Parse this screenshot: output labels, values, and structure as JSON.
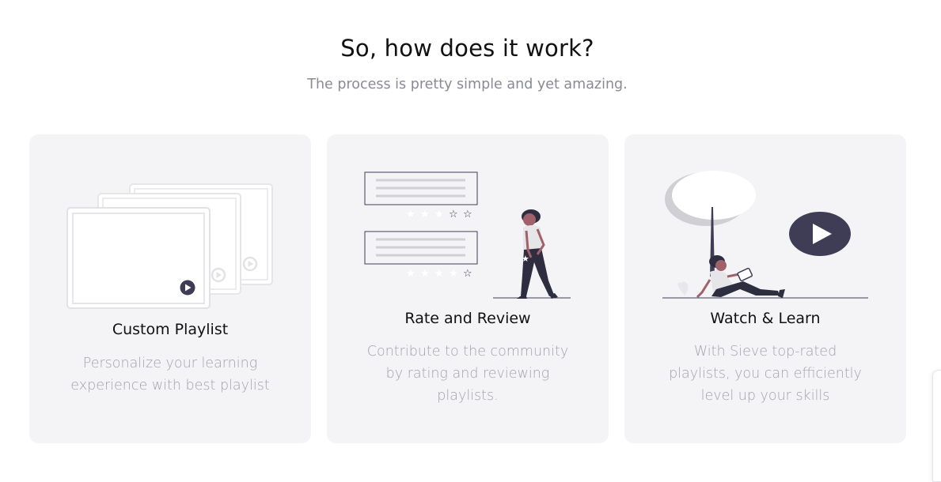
{
  "section": {
    "title": "So, how does it work?",
    "subtitle": "The process is pretty simple and yet amazing."
  },
  "cards": [
    {
      "title": "Custom Playlist",
      "description": "Personalize your learning experience with best playlist",
      "illustration": "stacked-video-playlist-icon"
    },
    {
      "title": "Rate and Review",
      "description": "Contribute to the community by rating and reviewing playlists.",
      "illustration": "person-rating-reviews-icon"
    },
    {
      "title": "Watch & Learn",
      "description": "With Sieve top-rated playlists, you can efficiently level up your skills",
      "illustration": "person-watching-video-icon"
    }
  ],
  "colors": {
    "card_background": "#f4f4f6",
    "heading": "#111111",
    "muted_text": "#a3a3ab",
    "dark_accent": "#3f3d56"
  }
}
